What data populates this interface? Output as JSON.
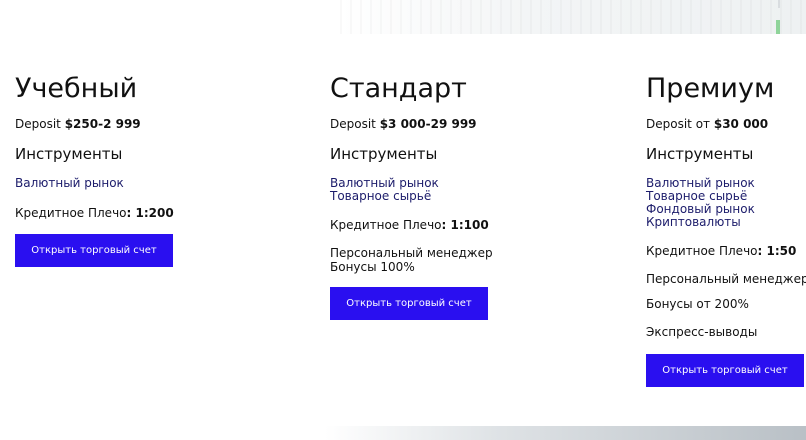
{
  "plans": [
    {
      "title": "Учебный",
      "deposit_prefix": "Deposit",
      "deposit_value": "$250-2 999",
      "instruments_heading": "Инструменты",
      "instruments": [
        "Валютный рынок"
      ],
      "leverage_label": "Кредитное Плечо",
      "leverage_value": ": 1:200",
      "button_label": "Открыть торговый счет"
    },
    {
      "title": "Стандарт",
      "deposit_prefix": "Deposit",
      "deposit_value": "$3 000-29 999",
      "instruments_heading": "Инструменты",
      "instruments": [
        "Валютный рынок",
        "Товарное сырьё"
      ],
      "leverage_label": "Кредитное Плечо",
      "leverage_value": ": 1:100",
      "extras": [
        "Персональный менеджер",
        "Бонусы 100%"
      ],
      "button_label": "Открыть торговый счет"
    },
    {
      "title": "Премиум",
      "deposit_prefix": "Deposit от",
      "deposit_value": "$30 000",
      "instruments_heading": "Инструменты",
      "instruments": [
        "Валютный рынок",
        "Товарное сырьё",
        "Фондовый рынок",
        "Криптовалюты"
      ],
      "leverage_label": "Кредитное Плечо",
      "leverage_value": ": 1:50",
      "extras": [
        "Персональный менеджер",
        "Бонусы от 200%",
        "Экспресс-выводы"
      ],
      "button_label": "Открыть торговый счет"
    }
  ],
  "colors": {
    "button_bg": "#2a0ff0",
    "button_text": "#ffffff",
    "instrument_link": "#1c1c6b",
    "text": "#111111"
  }
}
